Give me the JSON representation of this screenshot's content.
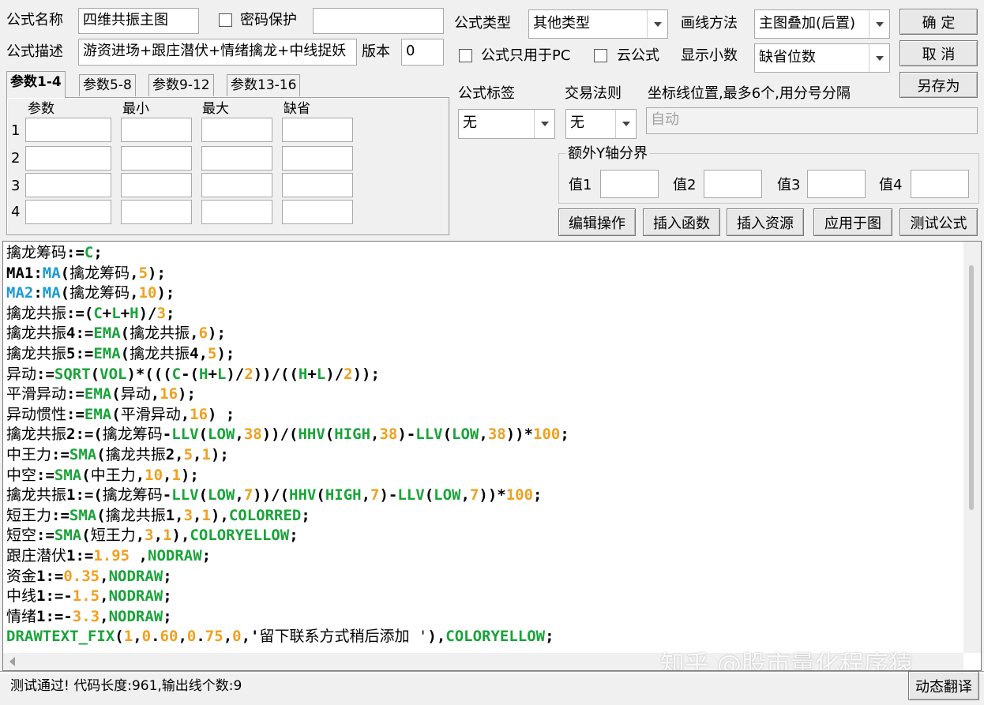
{
  "labels": {
    "formula_name": "公式名称",
    "password": "密码保护",
    "formula_desc": "公式描述",
    "version": "版本",
    "formula_type": "公式类型",
    "draw_method": "画线方法",
    "pc_only": "公式只用于PC",
    "cloud": "云公式",
    "show_decimals": "显示小数",
    "formula_tag": "公式标签",
    "trade_rule": "交易法则",
    "axis_pos": "坐标线位置,最多6个,用分号分隔",
    "extra_y": "额外Y轴分界",
    "val1": "值1",
    "val2": "值2",
    "val3": "值3",
    "val4": "值4"
  },
  "fields": {
    "name": "四维共振主图",
    "desc": "游资进场+跟庄潜伏+情绪擒龙+中线捉妖",
    "version": "0",
    "formula_type": "其他类型",
    "draw_method": "主图叠加(后置)",
    "decimals": "缺省位数",
    "tag": "无",
    "trade_rule": "无",
    "axis_pos": "自动"
  },
  "buttons": {
    "ok": "确  定",
    "cancel": "取  消",
    "save_as": "另存为",
    "edit_op": "编辑操作",
    "insert_func": "插入函数",
    "insert_res": "插入资源",
    "apply": "应用于图",
    "test": "测试公式",
    "dyn_translate": "动态翻译"
  },
  "tabs": [
    "参数1-4",
    "参数5-8",
    "参数9-12",
    "参数13-16"
  ],
  "param_headers": [
    "参数",
    "最小",
    "最大",
    "缺省"
  ],
  "param_rows": [
    "1",
    "2",
    "3",
    "4"
  ],
  "status": "测试通过! 代码长度:961,输出线个数:9",
  "watermark": "知乎 @股市量化程序猿",
  "code_lines": [
    [
      [
        "擒龙筹码",
        "n"
      ],
      [
        ":=",
        "o"
      ],
      [
        "C",
        "f"
      ],
      [
        ";",
        "o"
      ]
    ],
    [
      [
        "MA1",
        "o"
      ],
      [
        ":",
        "o"
      ],
      [
        "MA",
        "u"
      ],
      [
        "(",
        "o"
      ],
      [
        "擒龙筹码",
        "n"
      ],
      [
        ",",
        "o"
      ],
      [
        "5",
        "num"
      ],
      [
        ");",
        "o"
      ]
    ],
    [
      [
        "MA2",
        "u"
      ],
      [
        ":",
        "o"
      ],
      [
        "MA",
        "u"
      ],
      [
        "(",
        "o"
      ],
      [
        "擒龙筹码",
        "n"
      ],
      [
        ",",
        "o"
      ],
      [
        "10",
        "num"
      ],
      [
        ");",
        "o"
      ]
    ],
    [
      [
        "擒龙共振",
        "n"
      ],
      [
        ":=(",
        "o"
      ],
      [
        "C",
        "f"
      ],
      [
        "+",
        "o"
      ],
      [
        "L",
        "f"
      ],
      [
        "+",
        "o"
      ],
      [
        "H",
        "f"
      ],
      [
        ")/",
        "o"
      ],
      [
        "3",
        "num"
      ],
      [
        ";",
        "o"
      ]
    ],
    [
      [
        "擒龙共振",
        "n"
      ],
      [
        "4:=",
        "o"
      ],
      [
        "EMA",
        "f"
      ],
      [
        "(",
        "o"
      ],
      [
        "擒龙共振",
        "n"
      ],
      [
        ",",
        "o"
      ],
      [
        "6",
        "num"
      ],
      [
        ");",
        "o"
      ]
    ],
    [
      [
        "擒龙共振",
        "n"
      ],
      [
        "5:=",
        "o"
      ],
      [
        "EMA",
        "f"
      ],
      [
        "(",
        "o"
      ],
      [
        "擒龙共振",
        "n"
      ],
      [
        "4,",
        "o"
      ],
      [
        "5",
        "num"
      ],
      [
        ");",
        "o"
      ]
    ],
    [
      [
        "异动",
        "n"
      ],
      [
        ":=",
        "o"
      ],
      [
        "SQRT",
        "f"
      ],
      [
        "(",
        "o"
      ],
      [
        "VOL",
        "f"
      ],
      [
        ")*(((",
        "o"
      ],
      [
        "C",
        "f"
      ],
      [
        "-(",
        "o"
      ],
      [
        "H",
        "f"
      ],
      [
        "+",
        "o"
      ],
      [
        "L",
        "f"
      ],
      [
        ")/",
        "o"
      ],
      [
        "2",
        "num"
      ],
      [
        "))/((",
        "o"
      ],
      [
        "H",
        "f"
      ],
      [
        "+",
        "o"
      ],
      [
        "L",
        "f"
      ],
      [
        ")/",
        "o"
      ],
      [
        "2",
        "num"
      ],
      [
        "));",
        "o"
      ]
    ],
    [
      [
        "平滑异动",
        "n"
      ],
      [
        ":=",
        "o"
      ],
      [
        "EMA",
        "f"
      ],
      [
        "(",
        "o"
      ],
      [
        "异动",
        "n"
      ],
      [
        ",",
        "o"
      ],
      [
        "16",
        "num"
      ],
      [
        ");",
        "o"
      ]
    ],
    [
      [
        "异动惯性",
        "n"
      ],
      [
        ":=",
        "o"
      ],
      [
        "EMA",
        "f"
      ],
      [
        "(",
        "o"
      ],
      [
        "平滑异动",
        "n"
      ],
      [
        ",",
        "o"
      ],
      [
        "16",
        "num"
      ],
      [
        ") ;",
        "o"
      ]
    ],
    [
      [
        "擒龙共振",
        "n"
      ],
      [
        "2:=(",
        "o"
      ],
      [
        "擒龙筹码",
        "n"
      ],
      [
        "-",
        "o"
      ],
      [
        "LLV",
        "f"
      ],
      [
        "(",
        "o"
      ],
      [
        "LOW",
        "f"
      ],
      [
        ",",
        "o"
      ],
      [
        "38",
        "num"
      ],
      [
        "))/(",
        "o"
      ],
      [
        "HHV",
        "f"
      ],
      [
        "(",
        "o"
      ],
      [
        "HIGH",
        "f"
      ],
      [
        ",",
        "o"
      ],
      [
        "38",
        "num"
      ],
      [
        ")-",
        "o"
      ],
      [
        "LLV",
        "f"
      ],
      [
        "(",
        "o"
      ],
      [
        "LOW",
        "f"
      ],
      [
        ",",
        "o"
      ],
      [
        "38",
        "num"
      ],
      [
        "))*",
        "o"
      ],
      [
        "100",
        "num"
      ],
      [
        ";",
        "o"
      ]
    ],
    [
      [
        "中王力",
        "n"
      ],
      [
        ":=",
        "o"
      ],
      [
        "SMA",
        "f"
      ],
      [
        "(",
        "o"
      ],
      [
        "擒龙共振",
        "n"
      ],
      [
        "2,",
        "o"
      ],
      [
        "5",
        "num"
      ],
      [
        ",",
        "o"
      ],
      [
        "1",
        "num"
      ],
      [
        ");",
        "o"
      ]
    ],
    [
      [
        "中空",
        "n"
      ],
      [
        ":=",
        "o"
      ],
      [
        "SMA",
        "f"
      ],
      [
        "(",
        "o"
      ],
      [
        "中王力",
        "n"
      ],
      [
        ",",
        "o"
      ],
      [
        "10",
        "num"
      ],
      [
        ",",
        "o"
      ],
      [
        "1",
        "num"
      ],
      [
        ");",
        "o"
      ]
    ],
    [
      [
        "擒龙共振",
        "n"
      ],
      [
        "1:=(",
        "o"
      ],
      [
        "擒龙筹码",
        "n"
      ],
      [
        "-",
        "o"
      ],
      [
        "LLV",
        "f"
      ],
      [
        "(",
        "o"
      ],
      [
        "LOW",
        "f"
      ],
      [
        ",",
        "o"
      ],
      [
        "7",
        "num"
      ],
      [
        "))/(",
        "o"
      ],
      [
        "HHV",
        "f"
      ],
      [
        "(",
        "o"
      ],
      [
        "HIGH",
        "f"
      ],
      [
        ",",
        "o"
      ],
      [
        "7",
        "num"
      ],
      [
        ")-",
        "o"
      ],
      [
        "LLV",
        "f"
      ],
      [
        "(",
        "o"
      ],
      [
        "LOW",
        "f"
      ],
      [
        ",",
        "o"
      ],
      [
        "7",
        "num"
      ],
      [
        "))*",
        "o"
      ],
      [
        "100",
        "num"
      ],
      [
        ";",
        "o"
      ]
    ],
    [
      [
        "短王力",
        "n"
      ],
      [
        ":=",
        "o"
      ],
      [
        "SMA",
        "f"
      ],
      [
        "(",
        "o"
      ],
      [
        "擒龙共振",
        "n"
      ],
      [
        "1,",
        "o"
      ],
      [
        "3",
        "num"
      ],
      [
        ",",
        "o"
      ],
      [
        "1",
        "num"
      ],
      [
        "),",
        "o"
      ],
      [
        "COLORRED",
        "k"
      ],
      [
        ";",
        "o"
      ]
    ],
    [
      [
        "短空",
        "n"
      ],
      [
        ":=",
        "o"
      ],
      [
        "SMA",
        "f"
      ],
      [
        "(",
        "o"
      ],
      [
        "短王力",
        "n"
      ],
      [
        ",",
        "o"
      ],
      [
        "3",
        "num"
      ],
      [
        ",",
        "o"
      ],
      [
        "1",
        "num"
      ],
      [
        "),",
        "o"
      ],
      [
        "COLORYELLOW",
        "k"
      ],
      [
        ";",
        "o"
      ]
    ],
    [
      [
        "跟庄潜伏",
        "n"
      ],
      [
        "1:=",
        "o"
      ],
      [
        "1.95",
        "num"
      ],
      [
        " ,",
        "o"
      ],
      [
        "NODRAW",
        "k"
      ],
      [
        ";",
        "o"
      ]
    ],
    [
      [
        "资金",
        "n"
      ],
      [
        "1:=",
        "o"
      ],
      [
        "0.35",
        "num"
      ],
      [
        ",",
        "o"
      ],
      [
        "NODRAW",
        "k"
      ],
      [
        ";",
        "o"
      ]
    ],
    [
      [
        "中线",
        "n"
      ],
      [
        "1:=-",
        "o"
      ],
      [
        "1.5",
        "num"
      ],
      [
        ",",
        "o"
      ],
      [
        "NODRAW",
        "k"
      ],
      [
        ";",
        "o"
      ]
    ],
    [
      [
        "情绪",
        "n"
      ],
      [
        "1:=-",
        "o"
      ],
      [
        "3.3",
        "num"
      ],
      [
        ",",
        "o"
      ],
      [
        "NODRAW",
        "k"
      ],
      [
        ";",
        "o"
      ]
    ],
    [
      [
        "DRAWTEXT_FIX",
        "k"
      ],
      [
        "(",
        "o"
      ],
      [
        "1",
        "num"
      ],
      [
        ",",
        "o"
      ],
      [
        "0",
        "num"
      ],
      [
        ".",
        "o"
      ],
      [
        "60",
        "num"
      ],
      [
        ",",
        "o"
      ],
      [
        "0",
        "num"
      ],
      [
        ".",
        "o"
      ],
      [
        "75",
        "num"
      ],
      [
        ",",
        "o"
      ],
      [
        "0",
        "num"
      ],
      [
        ",'",
        "o"
      ],
      [
        "留下联系方式稍后添加 '",
        "s"
      ],
      [
        "),",
        "o"
      ],
      [
        "COLORYELLOW",
        "k"
      ],
      [
        ";",
        "o"
      ]
    ]
  ],
  "colors": {
    "func": "#1aa33a",
    "userfunc": "#1a9bd7",
    "number": "#f0a020"
  }
}
